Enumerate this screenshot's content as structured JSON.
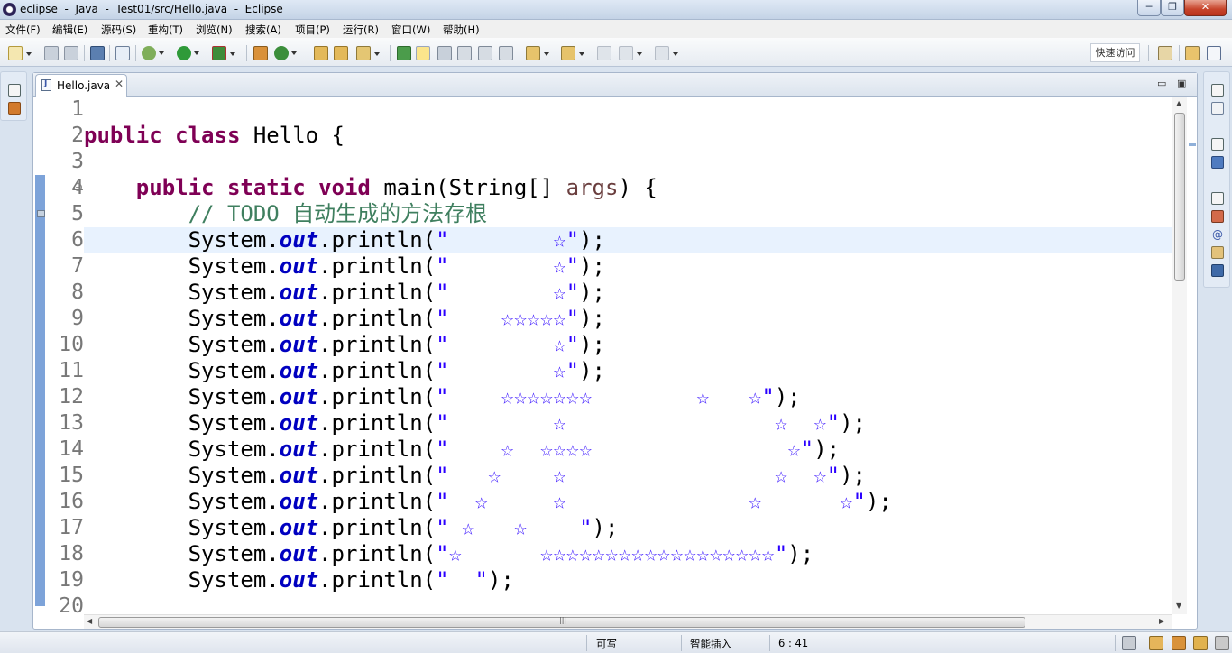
{
  "window": {
    "title": "eclipse  -  Java  -  Test01/src/Hello.java  -  Eclipse",
    "min": "─",
    "max": "❐",
    "close": "✕"
  },
  "menu": [
    "文件(F)",
    "编辑(E)",
    "源码(S)",
    "重构(T)",
    "浏览(N)",
    "搜索(A)",
    "项目(P)",
    "运行(R)",
    "窗口(W)",
    "帮助(H)"
  ],
  "toolbar": {
    "quick_access": "快速访问",
    "icons": [
      "new-icon",
      "save-icon",
      "save-all-icon",
      "console-icon",
      "skip-breakpoints-icon",
      "debug-icon",
      "run-icon",
      "coverage-icon",
      "new-java-project-icon",
      "new-class-icon",
      "open-type-icon",
      "open-task-icon",
      "search-icon",
      "toggle-mark-icon",
      "next-annotation-icon",
      "prev-annotation-icon",
      "last-edit-icon",
      "back-icon",
      "forward-icon",
      "perspective-icon",
      "java-perspective-icon"
    ]
  },
  "editor": {
    "tab_label": "Hello.java",
    "tab_close": "✕",
    "minimize": "▭",
    "maximize": "▣",
    "current_line": 6,
    "line_numbers": [
      "1",
      "2",
      "3",
      "4",
      "5",
      "6",
      "7",
      "8",
      "9",
      "10",
      "11",
      "12",
      "13",
      "14",
      "15",
      "16",
      "17",
      "18",
      "19",
      "20"
    ],
    "code": {
      "l2": {
        "kw": "public class",
        "rest": " Hello {"
      },
      "l4": {
        "indent": "    ",
        "kw": "public static void",
        "mid": " main(String[] ",
        "param": "args",
        "end": ") {"
      },
      "l5": {
        "indent": "        ",
        "comment": "// TODO 自动生成的方法存根"
      },
      "println": {
        "indent": "        ",
        "sys": "System.",
        "field": "out",
        "method": ".println(",
        "end": ");"
      },
      "strings": [
        "\"        ☆\"",
        "\"        ☆\"",
        "\"        ☆\"",
        "\"    ☆☆☆☆☆\"",
        "\"        ☆\"",
        "\"        ☆\"",
        "\"    ☆☆☆☆☆☆☆        ☆   ☆\"",
        "\"        ☆                ☆  ☆\"",
        "\"    ☆  ☆☆☆☆               ☆\"",
        "\"   ☆    ☆                ☆  ☆\"",
        "\"  ☆     ☆              ☆      ☆\"",
        "\" ☆   ☆    \"",
        "\"☆      ☆☆☆☆☆☆☆☆☆☆☆☆☆☆☆☆☆☆\"",
        "\"  \""
      ]
    }
  },
  "status": {
    "writable": "可写",
    "insert_mode": "智能插入",
    "position": "6 : 41"
  }
}
